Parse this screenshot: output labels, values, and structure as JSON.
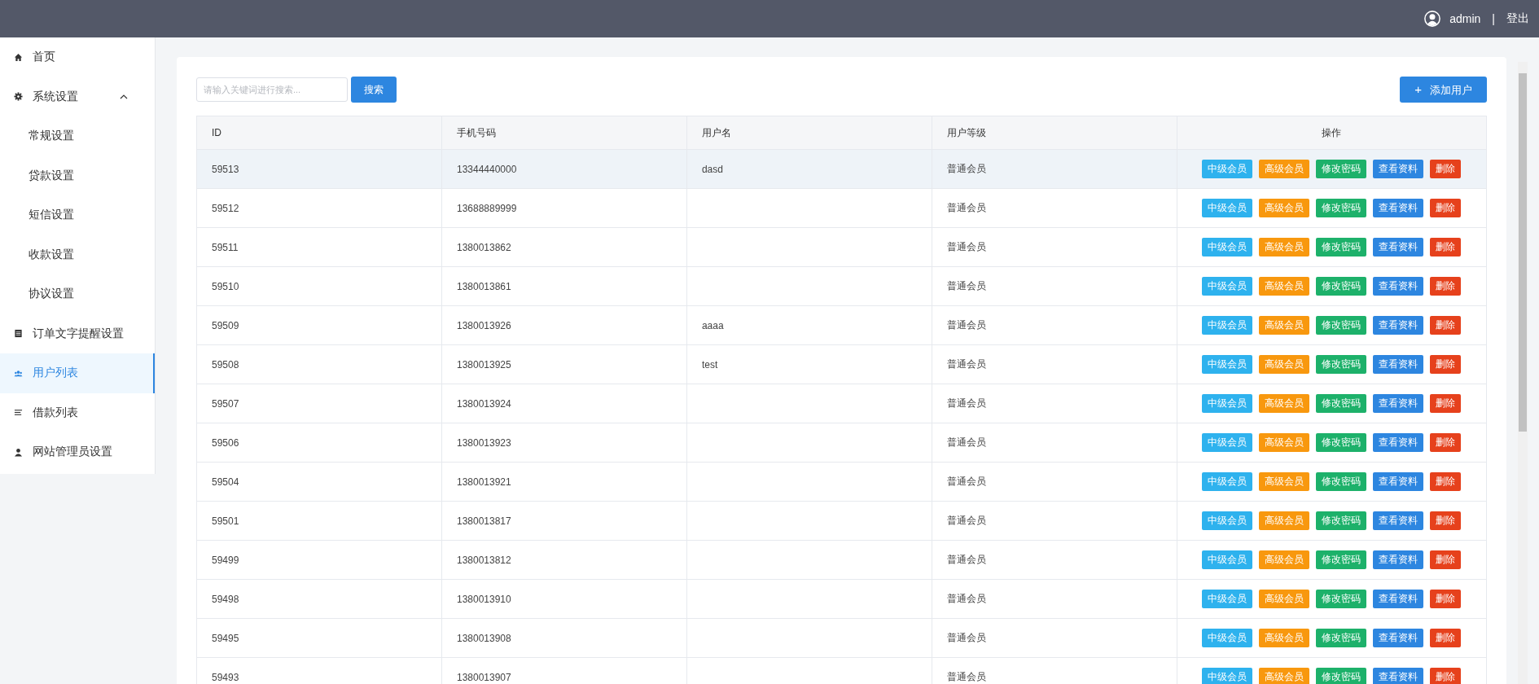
{
  "top_bar": {
    "user": "admin",
    "separator": "|",
    "logout": "登出"
  },
  "sidebar": {
    "items": [
      {
        "label": "首页",
        "selected": false
      },
      {
        "label": "系统设置",
        "selected": false,
        "expanded": true,
        "children": [
          {
            "label": "常规设置",
            "selected": false
          },
          {
            "label": "贷款设置",
            "selected": false
          },
          {
            "label": "短信设置",
            "selected": false
          },
          {
            "label": "收款设置",
            "selected": false
          },
          {
            "label": "协议设置",
            "selected": false
          }
        ]
      },
      {
        "label": "订单文字提醒设置",
        "selected": false
      },
      {
        "label": "用户列表",
        "selected": true
      },
      {
        "label": "借款列表",
        "selected": false
      },
      {
        "label": "网站管理员设置",
        "selected": false
      }
    ]
  },
  "search": {
    "placeholder": "请输入关键词进行搜索...",
    "button": "搜索"
  },
  "add_button": {
    "icon": "+",
    "label": "添加用户"
  },
  "table": {
    "columns": [
      "ID",
      "手机号码",
      "用户名",
      "用户等级",
      "操作"
    ],
    "rows": [
      {
        "id": "59513",
        "phone": "13344440000",
        "username": "dasd",
        "level": "普通会员",
        "selected": true,
        "actions": [
          {
            "label": "中级会员",
            "color": "#2eb2ee"
          },
          {
            "label": "高级会员",
            "color": "#f8980e"
          },
          {
            "label": "修改密码",
            "color": "#1db16a"
          },
          {
            "label": "查看资料",
            "color": "#2d86e0"
          },
          {
            "label": "删除",
            "color": "#e6411c"
          }
        ]
      },
      {
        "id": "59512",
        "phone": "13688889999",
        "username": "",
        "level": "普通会员",
        "selected": false,
        "actions": [
          {
            "label": "中级会员",
            "color": "#2eb2ee"
          },
          {
            "label": "高级会员",
            "color": "#f8980e"
          },
          {
            "label": "修改密码",
            "color": "#1db16a"
          },
          {
            "label": "查看资料",
            "color": "#2d86e0"
          },
          {
            "label": "删除",
            "color": "#e6411c"
          }
        ]
      },
      {
        "id": "59511",
        "phone": "1380013862",
        "username": "",
        "level": "普通会员",
        "selected": false,
        "actions": [
          {
            "label": "中级会员",
            "color": "#2eb2ee"
          },
          {
            "label": "高级会员",
            "color": "#f8980e"
          },
          {
            "label": "修改密码",
            "color": "#1db16a"
          },
          {
            "label": "查看资料",
            "color": "#2d86e0"
          },
          {
            "label": "删除",
            "color": "#e6411c"
          }
        ]
      },
      {
        "id": "59510",
        "phone": "1380013861",
        "username": "",
        "level": "普通会员",
        "selected": false,
        "actions": [
          {
            "label": "中级会员",
            "color": "#2eb2ee"
          },
          {
            "label": "高级会员",
            "color": "#f8980e"
          },
          {
            "label": "修改密码",
            "color": "#1db16a"
          },
          {
            "label": "查看资料",
            "color": "#2d86e0"
          },
          {
            "label": "删除",
            "color": "#e6411c"
          }
        ]
      },
      {
        "id": "59509",
        "phone": "1380013926",
        "username": "aaaa",
        "level": "普通会员",
        "selected": false,
        "actions": [
          {
            "label": "中级会员",
            "color": "#2eb2ee"
          },
          {
            "label": "高级会员",
            "color": "#f8980e"
          },
          {
            "label": "修改密码",
            "color": "#1db16a"
          },
          {
            "label": "查看资料",
            "color": "#2d86e0"
          },
          {
            "label": "删除",
            "color": "#e6411c"
          }
        ]
      },
      {
        "id": "59508",
        "phone": "1380013925",
        "username": "test",
        "level": "普通会员",
        "selected": false,
        "actions": [
          {
            "label": "中级会员",
            "color": "#2eb2ee"
          },
          {
            "label": "高级会员",
            "color": "#f8980e"
          },
          {
            "label": "修改密码",
            "color": "#1db16a"
          },
          {
            "label": "查看资料",
            "color": "#2d86e0"
          },
          {
            "label": "删除",
            "color": "#e6411c"
          }
        ]
      },
      {
        "id": "59507",
        "phone": "1380013924",
        "username": "",
        "level": "普通会员",
        "selected": false,
        "actions": [
          {
            "label": "中级会员",
            "color": "#2eb2ee"
          },
          {
            "label": "高级会员",
            "color": "#f8980e"
          },
          {
            "label": "修改密码",
            "color": "#1db16a"
          },
          {
            "label": "查看资料",
            "color": "#2d86e0"
          },
          {
            "label": "删除",
            "color": "#e6411c"
          }
        ]
      },
      {
        "id": "59506",
        "phone": "1380013923",
        "username": "",
        "level": "普通会员",
        "selected": false,
        "actions": [
          {
            "label": "中级会员",
            "color": "#2eb2ee"
          },
          {
            "label": "高级会员",
            "color": "#f8980e"
          },
          {
            "label": "修改密码",
            "color": "#1db16a"
          },
          {
            "label": "查看资料",
            "color": "#2d86e0"
          },
          {
            "label": "删除",
            "color": "#e6411c"
          }
        ]
      },
      {
        "id": "59504",
        "phone": "1380013921",
        "username": "",
        "level": "普通会员",
        "selected": false,
        "actions": [
          {
            "label": "中级会员",
            "color": "#2eb2ee"
          },
          {
            "label": "高级会员",
            "color": "#f8980e"
          },
          {
            "label": "修改密码",
            "color": "#1db16a"
          },
          {
            "label": "查看资料",
            "color": "#2d86e0"
          },
          {
            "label": "删除",
            "color": "#e6411c"
          }
        ]
      },
      {
        "id": "59501",
        "phone": "1380013817",
        "username": "",
        "level": "普通会员",
        "selected": false,
        "actions": [
          {
            "label": "中级会员",
            "color": "#2eb2ee"
          },
          {
            "label": "高级会员",
            "color": "#f8980e"
          },
          {
            "label": "修改密码",
            "color": "#1db16a"
          },
          {
            "label": "查看资料",
            "color": "#2d86e0"
          },
          {
            "label": "删除",
            "color": "#e6411c"
          }
        ]
      },
      {
        "id": "59499",
        "phone": "1380013812",
        "username": "",
        "level": "普通会员",
        "selected": false,
        "actions": [
          {
            "label": "中级会员",
            "color": "#2eb2ee"
          },
          {
            "label": "高级会员",
            "color": "#f8980e"
          },
          {
            "label": "修改密码",
            "color": "#1db16a"
          },
          {
            "label": "查看资料",
            "color": "#2d86e0"
          },
          {
            "label": "删除",
            "color": "#e6411c"
          }
        ]
      },
      {
        "id": "59498",
        "phone": "1380013910",
        "username": "",
        "level": "普通会员",
        "selected": false,
        "actions": [
          {
            "label": "中级会员",
            "color": "#2eb2ee"
          },
          {
            "label": "高级会员",
            "color": "#f8980e"
          },
          {
            "label": "修改密码",
            "color": "#1db16a"
          },
          {
            "label": "查看资料",
            "color": "#2d86e0"
          },
          {
            "label": "删除",
            "color": "#e6411c"
          }
        ]
      },
      {
        "id": "59495",
        "phone": "1380013908",
        "username": "",
        "level": "普通会员",
        "selected": false,
        "actions": [
          {
            "label": "中级会员",
            "color": "#2eb2ee"
          },
          {
            "label": "高级会员",
            "color": "#f8980e"
          },
          {
            "label": "修改密码",
            "color": "#1db16a"
          },
          {
            "label": "查看资料",
            "color": "#2d86e0"
          },
          {
            "label": "删除",
            "color": "#e6411c"
          }
        ]
      },
      {
        "id": "59493",
        "phone": "1380013907",
        "username": "",
        "level": "普通会员",
        "selected": false,
        "actions": [
          {
            "label": "中级会员",
            "color": "#2eb2ee"
          },
          {
            "label": "高级会员",
            "color": "#f8980e"
          },
          {
            "label": "修改密码",
            "color": "#1db16a"
          },
          {
            "label": "查看资料",
            "color": "#2d86e0"
          },
          {
            "label": "删除",
            "color": "#e6411c"
          }
        ]
      }
    ]
  }
}
